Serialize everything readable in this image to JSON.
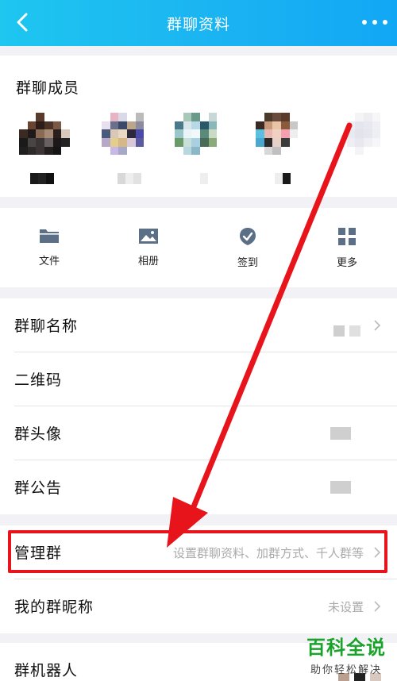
{
  "header": {
    "title": "群聊资料",
    "back_icon": "chevron-left-icon",
    "more_icon": "more-dots-icon"
  },
  "members": {
    "label": "群聊成员"
  },
  "tools": [
    {
      "label": "文件",
      "icon": "folder-icon"
    },
    {
      "label": "相册",
      "icon": "image-icon"
    },
    {
      "label": "签到",
      "icon": "check-badge-icon"
    },
    {
      "label": "更多",
      "icon": "grid-icon"
    }
  ],
  "rows": {
    "name": {
      "label": "群聊名称"
    },
    "qr": {
      "label": "二维码"
    },
    "avatar": {
      "label": "群头像"
    },
    "notice": {
      "label": "群公告"
    },
    "manage": {
      "label": "管理群",
      "value": "设置群聊资料、加群方式、千人群等"
    },
    "nickname": {
      "label": "我的群昵称",
      "value": "未设置"
    },
    "robot": {
      "label": "群机器人"
    }
  },
  "watermark": {
    "main": "百科全说",
    "sub": "助你轻松解决"
  },
  "colors": {
    "header": "#1ab2f2",
    "highlight": "#e8141c",
    "watermark": "#1aa32a"
  }
}
